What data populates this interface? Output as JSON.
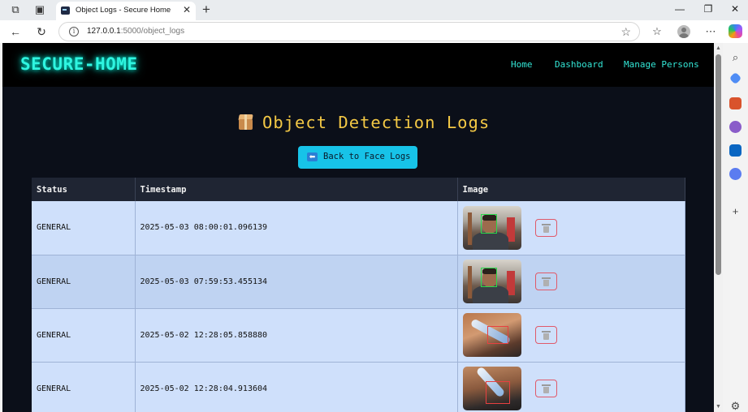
{
  "browser": {
    "tab_title": "Object Logs - Secure Home",
    "url_host": "127.0.0.1",
    "url_path": ":5000/object_logs"
  },
  "site": {
    "logo": "SECURE-HOME",
    "nav": [
      "Home",
      "Dashboard",
      "Manage Persons"
    ],
    "accent_color": "#2ff5e0",
    "title_color": "#f3c845"
  },
  "page": {
    "title": "Object Detection Logs",
    "title_icon": "package-icon",
    "back_button": "Back to Face Logs"
  },
  "table": {
    "headers": [
      "Status",
      "Timestamp",
      "Image"
    ],
    "rows": [
      {
        "status": "GENERAL",
        "timestamp": "2025-05-03 08:00:01.096139"
      },
      {
        "status": "GENERAL",
        "timestamp": "2025-05-03 07:59:53.455134"
      },
      {
        "status": "GENERAL",
        "timestamp": "2025-05-02 12:28:05.858880"
      },
      {
        "status": "GENERAL",
        "timestamp": "2025-05-02 12:28:04.913604"
      }
    ]
  }
}
